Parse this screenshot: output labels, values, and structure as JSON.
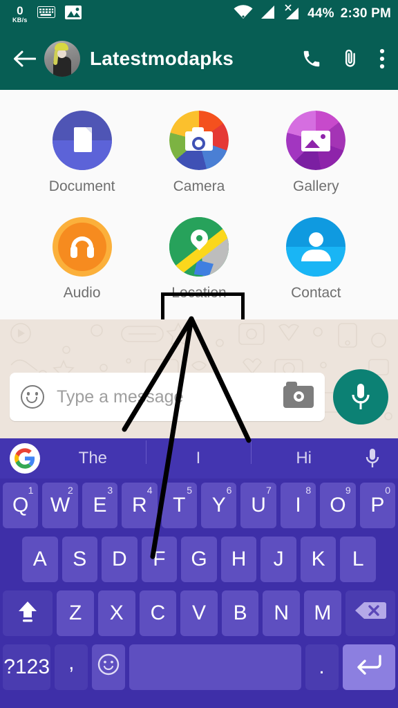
{
  "statusbar": {
    "net_speed_value": "0",
    "net_speed_unit": "KB/s",
    "keyboard_icon": "keyboard-icon",
    "image_icon": "image-icon",
    "wifi_icon": "wifi-icon",
    "signal_icon": "signal-bars-icon",
    "signal_no_sim_icon": "signal-no-sim-icon",
    "battery": "44%",
    "time": "2:30 PM"
  },
  "appbar": {
    "back_icon": "back-arrow-icon",
    "avatar": "contact-avatar",
    "title": "Latestmodapks",
    "call_icon": "phone-icon",
    "attach_icon": "paperclip-icon",
    "menu_icon": "overflow-menu-icon"
  },
  "attachments": {
    "items": [
      {
        "label": "Document",
        "icon": "document-icon",
        "color": "#4F55B5",
        "highlighted": false
      },
      {
        "label": "Camera",
        "icon": "camera-icon",
        "color": "#E53935",
        "highlighted": false
      },
      {
        "label": "Gallery",
        "icon": "gallery-icon",
        "color": "#8E24AA",
        "highlighted": false
      },
      {
        "label": "Audio",
        "icon": "audio-headphones-icon",
        "color": "#F68B1F",
        "highlighted": false
      },
      {
        "label": "Location",
        "icon": "location-pin-map-icon",
        "color": "#27A25B",
        "highlighted": true
      },
      {
        "label": "Contact",
        "icon": "contact-person-icon",
        "color": "#19B5F5",
        "highlighted": false
      }
    ],
    "highlight_color": "#000000"
  },
  "composer": {
    "emoji_icon": "emoji-smiley-icon",
    "placeholder": "Type a message",
    "value": "",
    "camera_icon": "camera-icon",
    "mic_icon": "microphone-icon",
    "mic_button_color": "#0C8174"
  },
  "keyboard": {
    "suggestion_logo": "google-g-logo",
    "suggestions": [
      "The",
      "I",
      "Hi"
    ],
    "suggestion_mic_icon": "microphone-icon",
    "rows": [
      [
        {
          "label": "Q",
          "sup": "1"
        },
        {
          "label": "W",
          "sup": "2"
        },
        {
          "label": "E",
          "sup": "3"
        },
        {
          "label": "R",
          "sup": "4"
        },
        {
          "label": "T",
          "sup": "5"
        },
        {
          "label": "Y",
          "sup": "6"
        },
        {
          "label": "U",
          "sup": "7"
        },
        {
          "label": "I",
          "sup": "8"
        },
        {
          "label": "O",
          "sup": "9"
        },
        {
          "label": "P",
          "sup": "0"
        }
      ],
      [
        {
          "label": "A"
        },
        {
          "label": "S"
        },
        {
          "label": "D"
        },
        {
          "label": "F"
        },
        {
          "label": "G"
        },
        {
          "label": "H"
        },
        {
          "label": "J"
        },
        {
          "label": "K"
        },
        {
          "label": "L"
        }
      ],
      [
        {
          "label": "",
          "icon": "shift-icon"
        },
        {
          "label": "Z"
        },
        {
          "label": "X"
        },
        {
          "label": "C"
        },
        {
          "label": "V"
        },
        {
          "label": "B"
        },
        {
          "label": "N"
        },
        {
          "label": "M"
        },
        {
          "label": "",
          "icon": "backspace-icon"
        }
      ],
      [
        {
          "label": "?123"
        },
        {
          "label": ","
        },
        {
          "label": "",
          "icon": "emoji-icon"
        },
        {
          "label": ""
        },
        {
          "label": "."
        },
        {
          "label": "",
          "icon": "enter-icon"
        }
      ]
    ],
    "bg_color": "#3E2FA8",
    "key_color": "#5E4FC0"
  },
  "annotation": {
    "type": "arrow-lines",
    "color": "#000000",
    "target": "Location"
  }
}
